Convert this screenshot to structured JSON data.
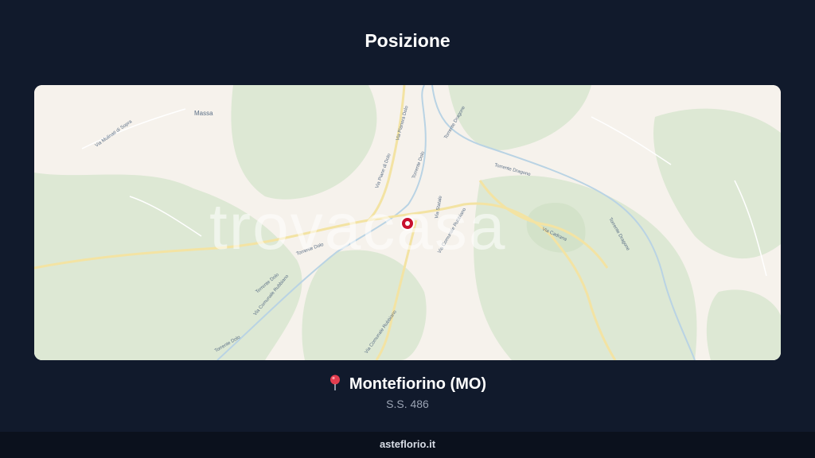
{
  "page": {
    "title": "Posizione"
  },
  "map": {
    "labels": {
      "town": "Massa",
      "via_mulinati": "Via Mulinati di Sopra",
      "via_piane_dolo": "Via Piane di Dolo",
      "via_pianora_dolo": "Via Pianora Dolo",
      "torrente_dolo": "Torrente Dolo",
      "torrente_dolo_2": "Torrente Dolo",
      "torrente_dolo_3": "Torrente Dolo",
      "torrente_dolo_4": "Torrente Dolo",
      "torrente_dragone": "Torrente Dragone",
      "torrente_dragone_2": "Torrente Dragone",
      "torrente_dragone_3": "Torrente Dragone",
      "via_comunale_rubbiano": "Via Comunale Rubbiano",
      "via_comunale_rubbiano_2": "Via Comunale Rubbiano",
      "via_statale": "Via Statale",
      "via_comunale_rubbiano_3": "Via Comunale Rubbiano",
      "via_cadrana": "Via Cadrana"
    },
    "watermark": "trovacasa",
    "marker_icon": "map-marker-icon"
  },
  "location": {
    "name": "Montefiorino (MO)",
    "address": "S.S. 486",
    "icon": "pin-icon"
  },
  "footer": {
    "brand": "asteflorio.it"
  },
  "colors": {
    "background": "#111a2c",
    "marker": "#c8102e"
  }
}
